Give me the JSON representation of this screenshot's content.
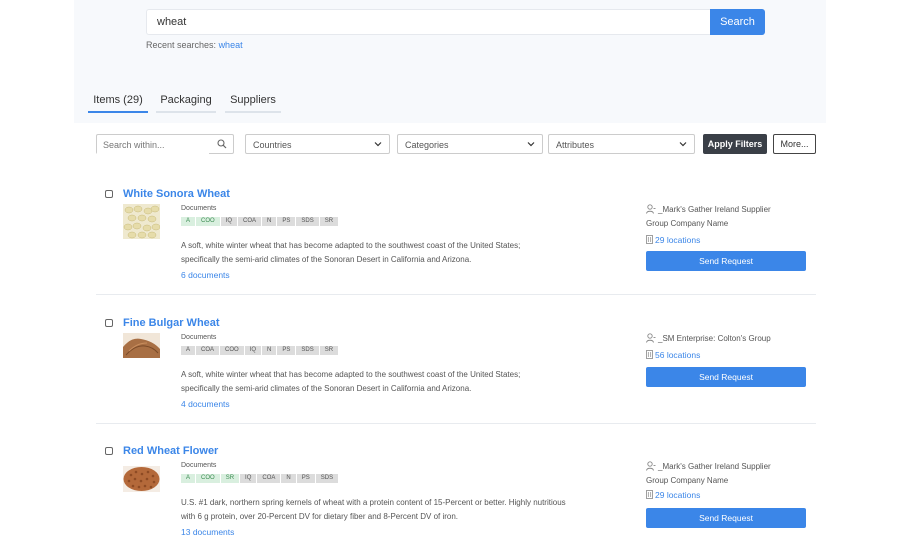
{
  "search": {
    "value": "wheat",
    "button_label": "Search"
  },
  "recent": {
    "label": "Recent searches:",
    "term": "wheat"
  },
  "tabs": [
    {
      "label": "Items (29)"
    },
    {
      "label": "Packaging"
    },
    {
      "label": "Suppliers"
    }
  ],
  "filters": {
    "search_within_placeholder": "Search within...",
    "countries": "Countries",
    "categories": "Categories",
    "attributes": "Attributes",
    "apply_label": "Apply Filters",
    "more_label": "More..."
  },
  "items": [
    {
      "title": "White Sonora Wheat",
      "documents_label": "Documents",
      "badges": [
        "A",
        "COO",
        "IQ",
        "COA",
        "N",
        "PS",
        "SDS",
        "SR"
      ],
      "green_badges": [
        "A",
        "COO"
      ],
      "description_line1": "A soft, white winter wheat that has become adapted to the southwest coast of the United States;",
      "description_line2": "specifically the semi-arid climates of the Sonoran Desert in California and Arizona.",
      "doc_count": "6 documents",
      "supplier_line1": "_Mark's Gather Ireland Supplier",
      "supplier_line2": "Group Company Name",
      "locations": "29 locations",
      "send_label": "Send Request"
    },
    {
      "title": "Fine Bulgar Wheat",
      "documents_label": "Documents",
      "badges": [
        "A",
        "COA",
        "COO",
        "IQ",
        "N",
        "PS",
        "SDS",
        "SR"
      ],
      "green_badges": [],
      "description_line1": "A soft, white winter wheat that has become adapted to the southwest coast of the United States;",
      "description_line2": "specifically the semi-arid climates of the Sonoran Desert in California and Arizona.",
      "doc_count": "4 documents",
      "supplier_line1": "_SM Enterprise: Colton's Group",
      "supplier_line2": "",
      "locations": "56 locations",
      "send_label": "Send Request"
    },
    {
      "title": "Red Wheat Flower",
      "documents_label": "Documents",
      "badges": [
        "A",
        "COO",
        "SR",
        "IQ",
        "COA",
        "N",
        "PS",
        "SDS"
      ],
      "green_badges": [
        "A",
        "COO",
        "SR"
      ],
      "description_line1": "U.S. #1 dark, northern spring kernels of wheat with a protein content of 15-Percent or better. Highly nutritious",
      "description_line2": "with 6 g protein, over 20-Percent DV for dietary fiber and 8-Percent DV of iron.",
      "doc_count": "13 documents",
      "supplier_line1": "_Mark's Gather Ireland Supplier",
      "supplier_line2": "Group Company Name",
      "locations": "29 locations",
      "send_label": "Send Request"
    }
  ],
  "icons": {
    "search_within": "magnifier-icon",
    "dropdown": "chevron-down-icon",
    "supplier": "user-icon",
    "locations": "building-icon"
  },
  "colors": {
    "accent": "#3b86e8",
    "apply_bg": "#3a3f47",
    "badge_green": "#d9efdf",
    "badge_gray": "#dcdcdc"
  }
}
